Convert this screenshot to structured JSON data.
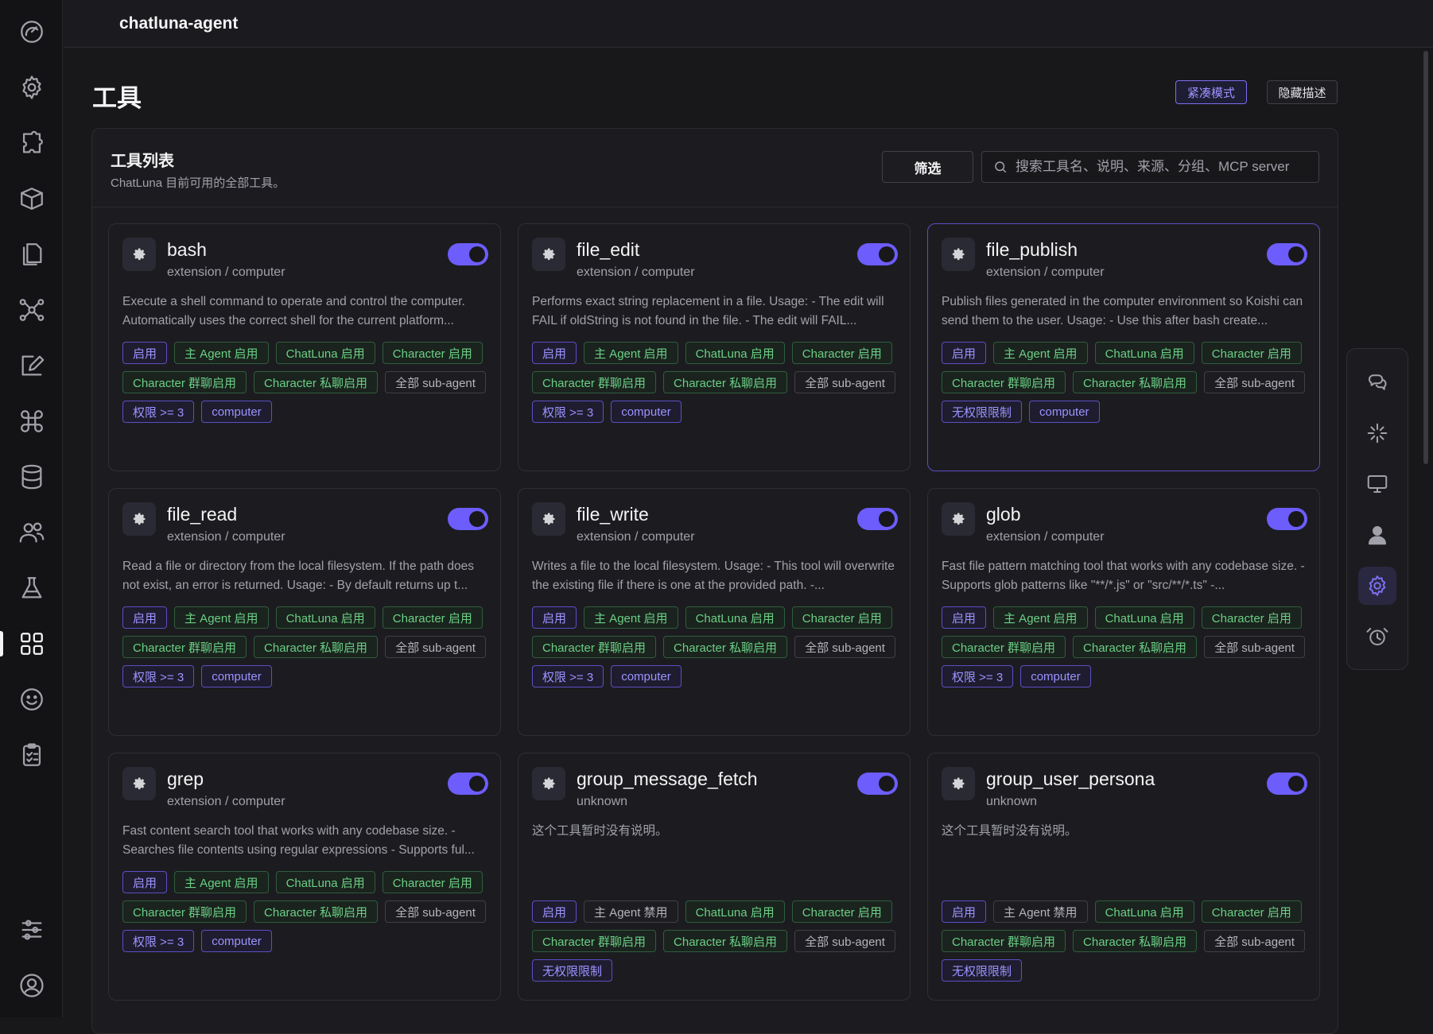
{
  "topbar": {
    "title": "chatluna-agent"
  },
  "page": {
    "title": "工具"
  },
  "header_buttons": {
    "compact": "紧凑模式",
    "hide_desc": "隐藏描述"
  },
  "panel": {
    "title": "工具列表",
    "subtitle": "ChatLuna 目前可用的全部工具。",
    "filter_label": "筛选",
    "search_placeholder": "搜索工具名、说明、来源、分组、MCP server"
  },
  "sidebar": {
    "icons": [
      "dashboard-icon",
      "settings-icon",
      "plugin-icon",
      "package-icon",
      "files-icon",
      "graph-icon",
      "edit-icon",
      "command-icon",
      "database-icon",
      "users-icon",
      "flask-icon",
      "apps-icon",
      "smile-icon",
      "clipboard-icon",
      "sliders-icon",
      "account-icon"
    ],
    "active": "apps-icon"
  },
  "rightbar": {
    "icons": [
      "chat-icon",
      "sparkle-icon",
      "monitor-icon",
      "person-icon",
      "gear-icon",
      "alarm-icon"
    ],
    "active": "gear-icon"
  },
  "colors": {
    "accent": "#6d5dfc",
    "tag_green": "#6bcf86",
    "tag_purple": "#9d93ff"
  },
  "tools": [
    {
      "name": "bash",
      "source": "extension / computer",
      "enabled": true,
      "description": "Execute a shell command to operate and control the computer. Automatically uses the correct shell for the current platform...",
      "tags": [
        {
          "text": "启用",
          "style": "purple"
        },
        {
          "text": "主 Agent 启用",
          "style": "green"
        },
        {
          "text": "ChatLuna 启用",
          "style": "green"
        },
        {
          "text": "Character 启用",
          "style": "green"
        },
        {
          "text": "Character 群聊启用",
          "style": "green"
        },
        {
          "text": "Character 私聊启用",
          "style": "green"
        },
        {
          "text": "全部 sub-agent",
          "style": "gray"
        },
        {
          "text": "权限 >= 3",
          "style": "purple"
        },
        {
          "text": "computer",
          "style": "purple"
        }
      ]
    },
    {
      "name": "file_edit",
      "source": "extension / computer",
      "enabled": true,
      "description": "Performs exact string replacement in a file. Usage: - The edit will FAIL if oldString is not found in the file. - The edit will FAIL...",
      "tags": [
        {
          "text": "启用",
          "style": "purple"
        },
        {
          "text": "主 Agent 启用",
          "style": "green"
        },
        {
          "text": "ChatLuna 启用",
          "style": "green"
        },
        {
          "text": "Character 启用",
          "style": "green"
        },
        {
          "text": "Character 群聊启用",
          "style": "green"
        },
        {
          "text": "Character 私聊启用",
          "style": "green"
        },
        {
          "text": "全部 sub-agent",
          "style": "gray"
        },
        {
          "text": "权限 >= 3",
          "style": "purple"
        },
        {
          "text": "computer",
          "style": "purple"
        }
      ]
    },
    {
      "name": "file_publish",
      "source": "extension / computer",
      "enabled": true,
      "description": "Publish files generated in the computer environment so Koishi can send them to the user. Usage: - Use this after bash create...",
      "tags": [
        {
          "text": "启用",
          "style": "purple"
        },
        {
          "text": "主 Agent 启用",
          "style": "green"
        },
        {
          "text": "ChatLuna 启用",
          "style": "green"
        },
        {
          "text": "Character 启用",
          "style": "green"
        },
        {
          "text": "Character 群聊启用",
          "style": "green"
        },
        {
          "text": "Character 私聊启用",
          "style": "green"
        },
        {
          "text": "全部 sub-agent",
          "style": "gray"
        },
        {
          "text": "无权限限制",
          "style": "purple"
        },
        {
          "text": "computer",
          "style": "purple"
        }
      ]
    },
    {
      "name": "file_read",
      "source": "extension / computer",
      "enabled": true,
      "description": "Read a file or directory from the local filesystem. If the path does not exist, an error is returned. Usage: - By default returns up t...",
      "tags": [
        {
          "text": "启用",
          "style": "purple"
        },
        {
          "text": "主 Agent 启用",
          "style": "green"
        },
        {
          "text": "ChatLuna 启用",
          "style": "green"
        },
        {
          "text": "Character 启用",
          "style": "green"
        },
        {
          "text": "Character 群聊启用",
          "style": "green"
        },
        {
          "text": "Character 私聊启用",
          "style": "green"
        },
        {
          "text": "全部 sub-agent",
          "style": "gray"
        },
        {
          "text": "权限 >= 3",
          "style": "purple"
        },
        {
          "text": "computer",
          "style": "purple"
        }
      ]
    },
    {
      "name": "file_write",
      "source": "extension / computer",
      "enabled": true,
      "description": "Writes a file to the local filesystem. Usage: - This tool will overwrite the existing file if there is one at the provided path. -...",
      "tags": [
        {
          "text": "启用",
          "style": "purple"
        },
        {
          "text": "主 Agent 启用",
          "style": "green"
        },
        {
          "text": "ChatLuna 启用",
          "style": "green"
        },
        {
          "text": "Character 启用",
          "style": "green"
        },
        {
          "text": "Character 群聊启用",
          "style": "green"
        },
        {
          "text": "Character 私聊启用",
          "style": "green"
        },
        {
          "text": "全部 sub-agent",
          "style": "gray"
        },
        {
          "text": "权限 >= 3",
          "style": "purple"
        },
        {
          "text": "computer",
          "style": "purple"
        }
      ]
    },
    {
      "name": "glob",
      "source": "extension / computer",
      "enabled": true,
      "description": "Fast file pattern matching tool that works with any codebase size. - Supports glob patterns like \"**/*.js\" or \"src/**/*.ts\" -...",
      "tags": [
        {
          "text": "启用",
          "style": "purple"
        },
        {
          "text": "主 Agent 启用",
          "style": "green"
        },
        {
          "text": "ChatLuna 启用",
          "style": "green"
        },
        {
          "text": "Character 启用",
          "style": "green"
        },
        {
          "text": "Character 群聊启用",
          "style": "green"
        },
        {
          "text": "Character 私聊启用",
          "style": "green"
        },
        {
          "text": "全部 sub-agent",
          "style": "gray"
        },
        {
          "text": "权限 >= 3",
          "style": "purple"
        },
        {
          "text": "computer",
          "style": "purple"
        }
      ]
    },
    {
      "name": "grep",
      "source": "extension / computer",
      "enabled": true,
      "description": "Fast content search tool that works with any codebase size. - Searches file contents using regular expressions - Supports ful...",
      "tags": [
        {
          "text": "启用",
          "style": "purple"
        },
        {
          "text": "主 Agent 启用",
          "style": "green"
        },
        {
          "text": "ChatLuna 启用",
          "style": "green"
        },
        {
          "text": "Character 启用",
          "style": "green"
        },
        {
          "text": "Character 群聊启用",
          "style": "green"
        },
        {
          "text": "Character 私聊启用",
          "style": "green"
        },
        {
          "text": "全部 sub-agent",
          "style": "gray"
        },
        {
          "text": "权限 >= 3",
          "style": "purple"
        },
        {
          "text": "computer",
          "style": "purple"
        }
      ]
    },
    {
      "name": "group_message_fetch",
      "source": "unknown",
      "enabled": true,
      "description": "这个工具暂时没有说明。",
      "tags": [
        {
          "text": "启用",
          "style": "purple"
        },
        {
          "text": "主 Agent 禁用",
          "style": "gray"
        },
        {
          "text": "ChatLuna 启用",
          "style": "green"
        },
        {
          "text": "Character 启用",
          "style": "green"
        },
        {
          "text": "Character 群聊启用",
          "style": "green"
        },
        {
          "text": "Character 私聊启用",
          "style": "green"
        },
        {
          "text": "全部 sub-agent",
          "style": "gray"
        },
        {
          "text": "无权限限制",
          "style": "purple"
        }
      ]
    },
    {
      "name": "group_user_persona",
      "source": "unknown",
      "enabled": true,
      "description": "这个工具暂时没有说明。",
      "tags": [
        {
          "text": "启用",
          "style": "purple"
        },
        {
          "text": "主 Agent 禁用",
          "style": "gray"
        },
        {
          "text": "ChatLuna 启用",
          "style": "green"
        },
        {
          "text": "Character 启用",
          "style": "green"
        },
        {
          "text": "Character 群聊启用",
          "style": "green"
        },
        {
          "text": "Character 私聊启用",
          "style": "green"
        },
        {
          "text": "全部 sub-agent",
          "style": "gray"
        },
        {
          "text": "无权限限制",
          "style": "purple"
        }
      ]
    }
  ]
}
